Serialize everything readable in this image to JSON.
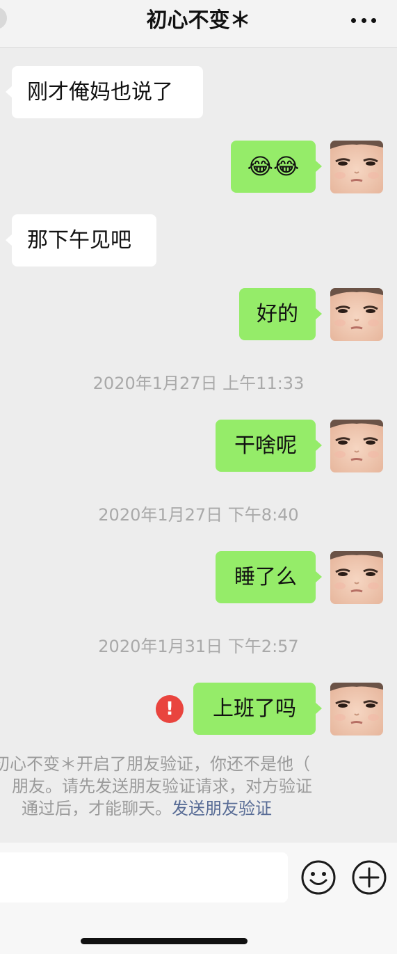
{
  "header": {
    "title": "初心不变＊"
  },
  "messages": {
    "m1": {
      "text": "刚才俺妈也说了"
    },
    "m2": {
      "emoji": "😂😂"
    },
    "m3": {
      "text": "那下午见吧"
    },
    "m4": {
      "text": "好的"
    },
    "ts1": "2020年1月27日 上午11:33",
    "m5": {
      "text": "干啥呢"
    },
    "ts2": "2020年1月27日 下午8:40",
    "m6": {
      "text": "睡了么"
    },
    "ts3": "2020年1月31日 下午2:57",
    "m7": {
      "text": "上班了吗",
      "status": "!"
    }
  },
  "notice": {
    "line1": "初心不变＊开启了朋友验证，你还不是他（",
    "line2": "朋友。请先发送朋友验证请求，对方验证",
    "line3": "通过后，才能聊天。",
    "link": "发送朋友验证"
  },
  "colors": {
    "outgoing_bubble": "#95ec69",
    "incoming_bubble": "#ffffff",
    "error": "#e9443e",
    "link": "#576b95"
  },
  "icons": {
    "more": "more-dots-icon",
    "emoji": "emoji-icon",
    "plus": "plus-icon",
    "error": "error-icon"
  }
}
